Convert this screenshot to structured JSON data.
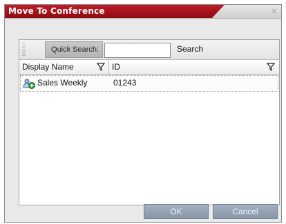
{
  "dialog": {
    "title": "Move To Conference",
    "close_glyph": "×"
  },
  "toolbar": {
    "quick_search_label": "Quick Search:",
    "quick_search_value": "",
    "search_label": "Search"
  },
  "table": {
    "columns": [
      "Display Name",
      "ID"
    ],
    "rows": [
      {
        "display_name": "Sales Weekly",
        "id": "01243",
        "icon": "conference-add-icon"
      }
    ]
  },
  "buttons": {
    "ok_label": "OK",
    "cancel_label": "Cancel"
  },
  "colors": {
    "title_accent": "#b01420",
    "button": "#8f9db0"
  }
}
